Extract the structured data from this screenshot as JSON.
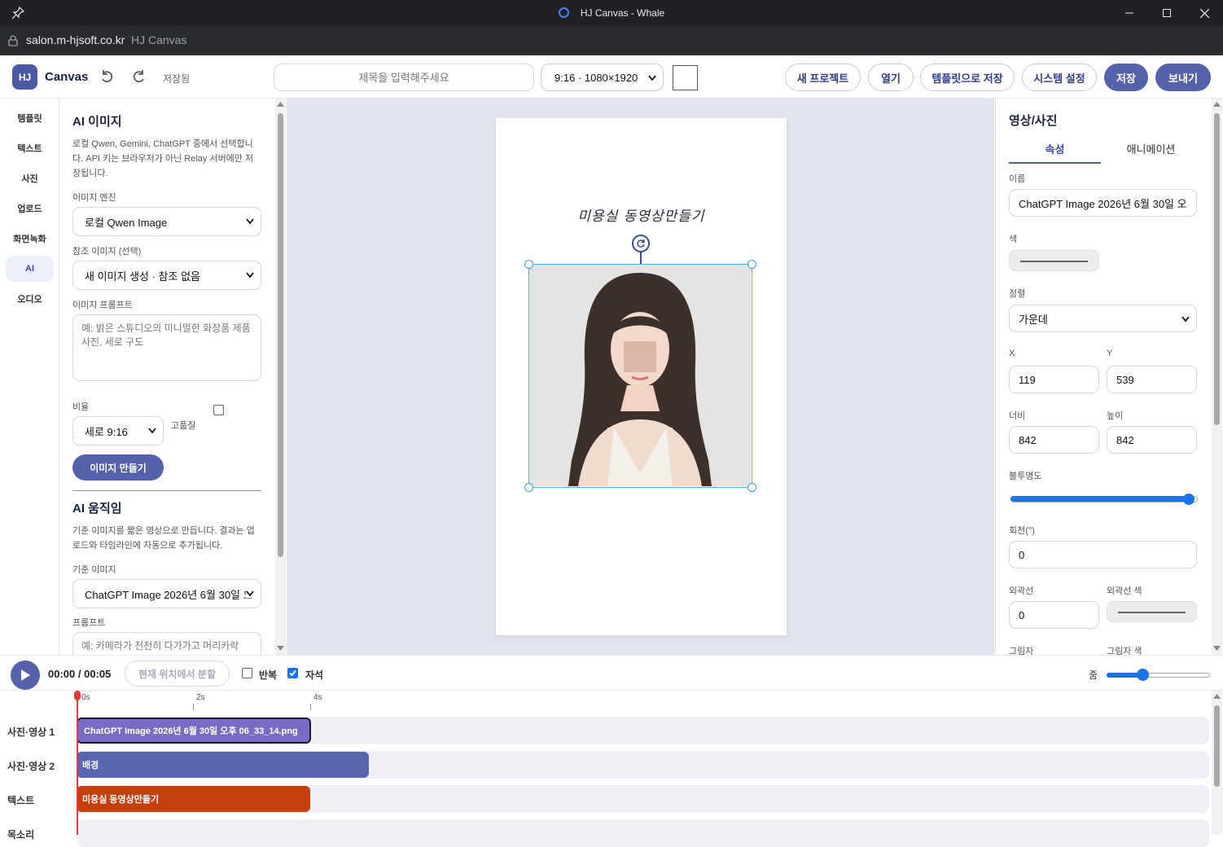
{
  "window": {
    "title": "HJ Canvas - Whale"
  },
  "address": {
    "url": "salon.m-hjsoft.co.kr",
    "page_title": "HJ Canvas"
  },
  "toolbar": {
    "logo": "HJ",
    "app_name": "Canvas",
    "saved_status": "저장됨",
    "title_placeholder": "제목을 입력해주세요",
    "ratio_selected": "9:16 · 1080×1920",
    "new_project": "새 프로젝트",
    "open": "열기",
    "save_template": "템플릿으로 저장",
    "settings": "시스템 설정",
    "save": "저장",
    "export": "보내기"
  },
  "leftnav": {
    "items": [
      "템플릿",
      "텍스트",
      "사진",
      "업로드",
      "화면녹화",
      "AI",
      "오디오"
    ],
    "active": "AI"
  },
  "ai_image": {
    "title": "AI 이미지",
    "description": "로컬 Qwen, Gemini, ChatGPT 중에서 선택합니다. API 키는 브라우저가 아닌 Relay 서버에만 저장됩니다.",
    "engine_label": "이미지 엔진",
    "engine_value": "로컬 Qwen Image",
    "ref_label": "참조 이미지 (선택)",
    "ref_value": "새 이미지 생성 · 참조 없음",
    "prompt_label": "이미지 프롬프트",
    "prompt_placeholder": "예: 밝은 스튜디오의 미니멀한 화장품 제품 사진, 세로 구도",
    "ratio_label": "비율",
    "ratio_value": "세로 9:16",
    "hq_label": "고품질",
    "generate": "이미지 만들기"
  },
  "ai_motion": {
    "title": "AI 움직임",
    "description": "기준 이미지를 짧은 영상으로 만듭니다. 결과는 업로드와 타임라인에 자동으로 추가됩니다.",
    "base_label": "기준 이미지",
    "base_value": "ChatGPT Image 2026년 6월 30일 오",
    "prompt_label": "프롬프트",
    "prompt_placeholder": "예: 카메라가 천천히 다가가고 머리카락"
  },
  "artboard": {
    "text": "미용실 동영상만들기"
  },
  "props": {
    "title": "영상/사진",
    "tabs": [
      "속성",
      "애니메이션"
    ],
    "name_label": "이름",
    "name_value": "ChatGPT Image 2026년 6월 30일 오",
    "color_label": "색",
    "align_label": "정렬",
    "align_value": "가운데",
    "x_label": "X",
    "x_value": "119",
    "y_label": "Y",
    "y_value": "539",
    "w_label": "너비",
    "w_value": "842",
    "h_label": "높이",
    "h_value": "842",
    "opacity_label": "불투명도",
    "opacity": 0.95,
    "rotation_label": "회전(°)",
    "rotation_value": "0",
    "stroke_label": "외곽선",
    "stroke_value": "0",
    "stroke_color_label": "외곽선 색",
    "shadow_label": "그림자",
    "shadow_color_label": "그림자 색"
  },
  "controls": {
    "time": "00:00 / 00:05",
    "split": "현재 위치에서 분할",
    "loop": "반복",
    "loop_checked": false,
    "magnet": "자석",
    "magnet_checked": true,
    "zoom": "줌",
    "zoom_level": 0.35
  },
  "timeline": {
    "ruler": [
      "0s",
      "2s",
      "4s"
    ],
    "tracks": [
      {
        "label": "사진·영상 1",
        "clip": "ChatGPT Image 2026년 6월 30일 오후 06_33_14.png",
        "color": "#7c6bc4"
      },
      {
        "label": "사진·영상 2",
        "clip": "배경",
        "color": "#5866ad"
      },
      {
        "label": "텍스트",
        "clip": "미용실 동영상만들기",
        "color": "#c4400f"
      },
      {
        "label": "목소리",
        "clip": "",
        "color": ""
      }
    ]
  }
}
